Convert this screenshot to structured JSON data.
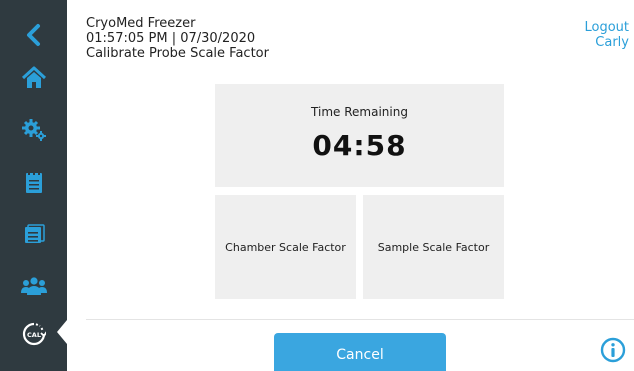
{
  "header": {
    "device_name": "CryoMed Freezer",
    "datetime": "01:57:05 PM | 07/30/2020",
    "page_title": "Calibrate Probe Scale Factor"
  },
  "user": {
    "logout_label": "Logout",
    "username": "Carly"
  },
  "sidebar": {
    "items": [
      {
        "icon": "back-arrow-icon"
      },
      {
        "icon": "home-icon"
      },
      {
        "icon": "gears-icon"
      },
      {
        "icon": "notepad-icon"
      },
      {
        "icon": "calendar-list-icon"
      },
      {
        "icon": "users-icon"
      },
      {
        "icon": "calibrate-icon",
        "icon_text": "CAL",
        "active": true
      }
    ]
  },
  "timer": {
    "label": "Time Remaining",
    "value": "04:58"
  },
  "scale_factors": {
    "chamber_label": "Chamber Scale Factor",
    "sample_label": "Sample Scale Factor"
  },
  "actions": {
    "cancel_label": "Cancel"
  },
  "colors": {
    "sidebar_bg": "#2f3a40",
    "accent_blue": "#3aa6e0",
    "tile_bg": "#efefef"
  }
}
